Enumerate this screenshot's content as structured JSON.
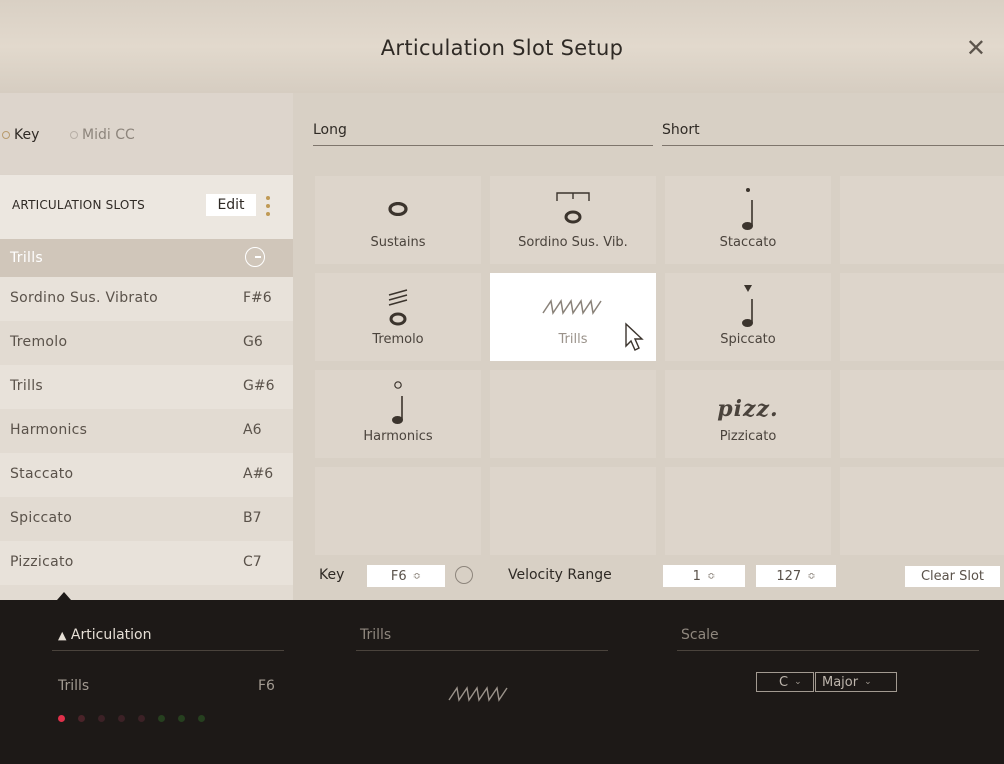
{
  "window": {
    "title": "Articulation Slot Setup",
    "close_glyph": "✕"
  },
  "mode": {
    "key_label": "Key",
    "midi_label": "Midi CC",
    "selected": "Key"
  },
  "slots": {
    "title": "ARTICULATION SLOTS",
    "edit_label": "Edit",
    "items": [
      {
        "name": "Trills",
        "note": "",
        "active": true
      },
      {
        "name": "Sordino Sus. Vibrato",
        "note": "F#6"
      },
      {
        "name": "Tremolo",
        "note": "G6"
      },
      {
        "name": "Trills",
        "note": "G#6"
      },
      {
        "name": "Harmonics",
        "note": "A6"
      },
      {
        "name": "Staccato",
        "note": "A#6"
      },
      {
        "name": "Spiccato",
        "note": "B7"
      },
      {
        "name": "Pizzicato",
        "note": "C7"
      }
    ]
  },
  "categories": {
    "long": "Long",
    "short": "Short"
  },
  "grid": {
    "cells": [
      {
        "label": "Sustains",
        "icon": "whole-note-icon"
      },
      {
        "label": "Sordino Sus. Vib.",
        "icon": "sordino-icon"
      },
      {
        "label": "Staccato",
        "icon": "staccato-icon"
      },
      {
        "label": "",
        "icon": ""
      },
      {
        "label": "Tremolo",
        "icon": "tremolo-icon"
      },
      {
        "label": "Trills",
        "icon": "trill-icon",
        "selected": true
      },
      {
        "label": "Spiccato",
        "icon": "spiccato-icon"
      },
      {
        "label": "",
        "icon": ""
      },
      {
        "label": "Harmonics",
        "icon": "harmonic-icon"
      },
      {
        "label": "",
        "icon": ""
      },
      {
        "label": "Pizzicato",
        "icon": "pizz-text",
        "text": "pizz."
      },
      {
        "label": "",
        "icon": ""
      },
      {
        "label": "",
        "icon": ""
      },
      {
        "label": "",
        "icon": ""
      },
      {
        "label": "",
        "icon": ""
      },
      {
        "label": "",
        "icon": ""
      }
    ]
  },
  "controls": {
    "key_label": "Key",
    "key_value": "F6",
    "velocity_label": "Velocity Range",
    "velocity_min": "1",
    "velocity_max": "127",
    "clear_label": "Clear Slot",
    "spin_arrow": "≎"
  },
  "footer": {
    "articulation_label": "Articulation",
    "articulation_arrow": "▲",
    "selected_name": "Trills",
    "selected_note": "F6",
    "trills_label": "Trills",
    "scale_label": "Scale",
    "scale_root": "C",
    "scale_mode": "Major",
    "dropdown_arrow": "⌄",
    "dot_colors": [
      "#e0304a",
      "#5a2530",
      "#4a2530",
      "#4a2530",
      "#4a2530",
      "#2e4a2a",
      "#2e4a2a",
      "#2e4a2a"
    ]
  }
}
